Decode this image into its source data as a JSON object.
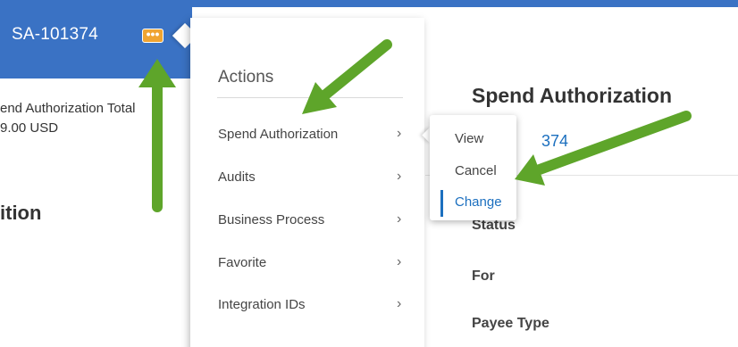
{
  "header": {
    "title": "SA-101374",
    "related_actions_glyph": "•••"
  },
  "background_left": {
    "total_label": "end Authorization Total",
    "total_value": "9.00 USD",
    "section_heading": "ition"
  },
  "background_right": {
    "title": "Spend Authorization",
    "link_text": "374",
    "fields": [
      "Status",
      "For",
      "Payee Type"
    ]
  },
  "actions_menu": {
    "heading": "Actions",
    "items": [
      {
        "label": "Spend Authorization",
        "chevron": "›"
      },
      {
        "label": "Audits",
        "chevron": "›"
      },
      {
        "label": "Business Process",
        "chevron": "›"
      },
      {
        "label": "Favorite",
        "chevron": "›"
      },
      {
        "label": "Integration IDs",
        "chevron": "›"
      }
    ]
  },
  "submenu": {
    "items": [
      {
        "label": "View"
      },
      {
        "label": "Cancel"
      },
      {
        "label": "Change",
        "selected": true
      }
    ]
  },
  "annotations": {
    "arrow_color": "#5ea52a",
    "arrows": [
      "arrow-up-icon",
      "arrow-down-left-icon",
      "arrow-left-icon"
    ]
  },
  "colors": {
    "header_blue": "#3a72c4",
    "related_actions_orange": "#f0a431",
    "link_blue": "#1b6fbf"
  }
}
